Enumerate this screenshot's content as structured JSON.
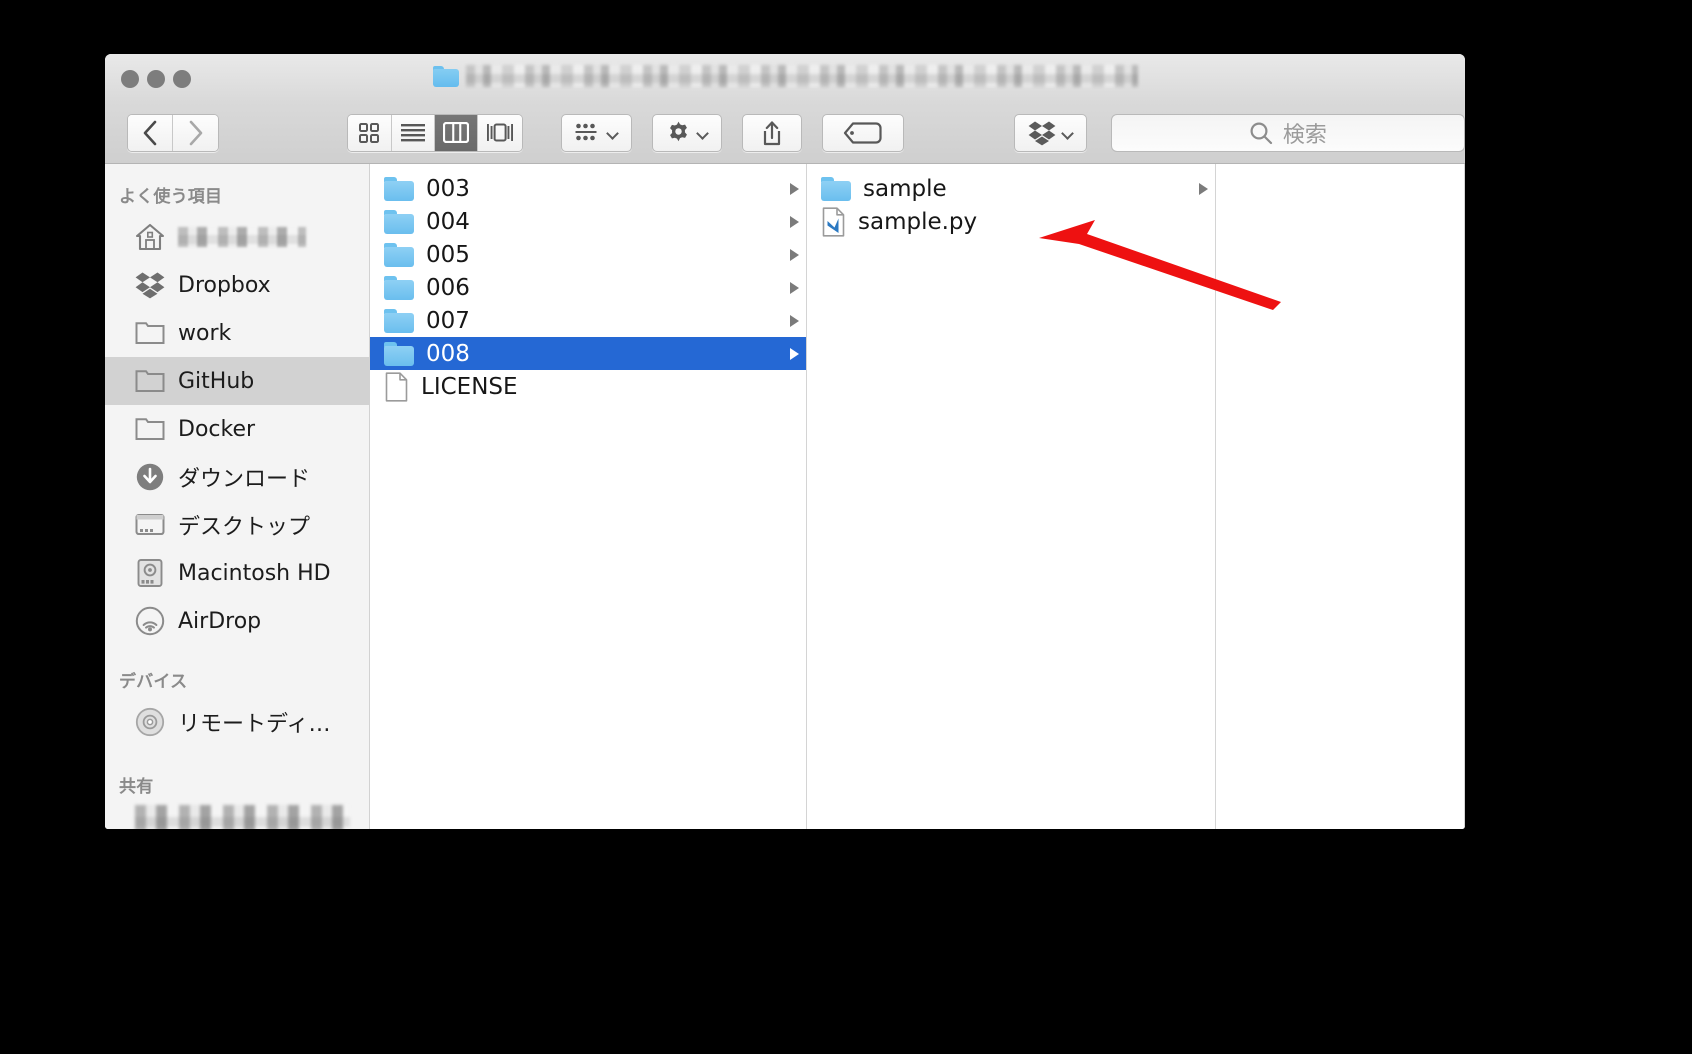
{
  "window": {
    "app": "Finder",
    "title_path_redacted": true,
    "traffic_lights": [
      "close",
      "minimize",
      "zoom"
    ],
    "state": "inactive"
  },
  "toolbar": {
    "back_label": "‹",
    "forward_label": "›",
    "view_modes": [
      {
        "name": "icon-view",
        "label": "icon",
        "active": false
      },
      {
        "name": "list-view",
        "label": "list",
        "active": false
      },
      {
        "name": "column-view",
        "label": "column",
        "active": true
      },
      {
        "name": "gallery-view",
        "label": "gallery",
        "active": false
      }
    ],
    "arrange_label": "arrange",
    "action_label": "action",
    "share_label": "share",
    "tags_label": "tags",
    "dropbox_label": "dropbox"
  },
  "search": {
    "placeholder": "検索",
    "value": ""
  },
  "sidebar": {
    "sections": [
      {
        "header": "よく使う項目",
        "items": [
          {
            "label": "",
            "icon": "home-icon",
            "redacted": true,
            "selected": false
          },
          {
            "label": "Dropbox",
            "icon": "dropbox-icon",
            "redacted": false,
            "selected": false
          },
          {
            "label": "work",
            "icon": "folder-icon",
            "redacted": false,
            "selected": false
          },
          {
            "label": "GitHub",
            "icon": "folder-icon",
            "redacted": false,
            "selected": true
          },
          {
            "label": "Docker",
            "icon": "folder-icon",
            "redacted": false,
            "selected": false
          },
          {
            "label": "ダウンロード",
            "icon": "download-icon",
            "redacted": false,
            "selected": false
          },
          {
            "label": "デスクトップ",
            "icon": "desktop-icon",
            "redacted": false,
            "selected": false
          },
          {
            "label": "Macintosh HD",
            "icon": "harddisk-icon",
            "redacted": false,
            "selected": false
          },
          {
            "label": "AirDrop",
            "icon": "airdrop-icon",
            "redacted": false,
            "selected": false
          }
        ]
      },
      {
        "header": "デバイス",
        "items": [
          {
            "label": "リモートディ…",
            "icon": "disc-icon",
            "redacted": false,
            "selected": false
          }
        ]
      },
      {
        "header": "共有",
        "items": [
          {
            "label": "",
            "icon": "server-icon",
            "redacted": true,
            "selected": false
          }
        ]
      }
    ]
  },
  "columns": [
    {
      "name": "column-1",
      "rows": [
        {
          "label": "003",
          "type": "folder",
          "selected": false,
          "has_chevron": true
        },
        {
          "label": "004",
          "type": "folder",
          "selected": false,
          "has_chevron": true
        },
        {
          "label": "005",
          "type": "folder",
          "selected": false,
          "has_chevron": true
        },
        {
          "label": "006",
          "type": "folder",
          "selected": false,
          "has_chevron": true
        },
        {
          "label": "007",
          "type": "folder",
          "selected": false,
          "has_chevron": true
        },
        {
          "label": "008",
          "type": "folder",
          "selected": true,
          "has_chevron": true
        },
        {
          "label": "LICENSE",
          "type": "document",
          "selected": false,
          "has_chevron": false
        }
      ]
    },
    {
      "name": "column-2",
      "rows": [
        {
          "label": "sample",
          "type": "folder",
          "selected": false,
          "has_chevron": true
        },
        {
          "label": "sample.py",
          "type": "python-file",
          "selected": false,
          "has_chevron": false
        }
      ]
    },
    {
      "name": "column-3",
      "rows": []
    }
  ],
  "annotation": {
    "type": "arrow",
    "color": "#ee1111",
    "points_to": "sample"
  },
  "colors": {
    "selection_blue": "#2568d4",
    "sidebar_bg": "#f4f4f4",
    "sidebar_selected": "#d2d2d2",
    "folder_blue": "#6abeee",
    "titlebar_gray": "#d9d9d9",
    "annotation_red": "#ee1111"
  }
}
